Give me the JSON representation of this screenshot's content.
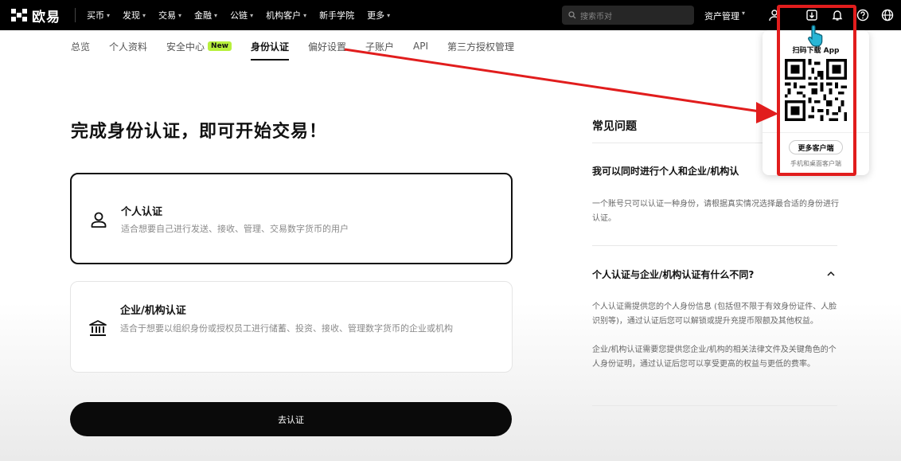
{
  "topnav": {
    "logo_text": "欧易",
    "items": [
      {
        "label": "买币",
        "has_chevron": true
      },
      {
        "label": "发现",
        "has_chevron": true
      },
      {
        "label": "交易",
        "has_chevron": true
      },
      {
        "label": "金融",
        "has_chevron": true
      },
      {
        "label": "公链",
        "has_chevron": true
      },
      {
        "label": "机构客户",
        "has_chevron": true
      },
      {
        "label": "新手学院",
        "has_chevron": false
      },
      {
        "label": "更多",
        "has_chevron": true
      }
    ],
    "search_placeholder": "搜索币对",
    "asset_label": "资产管理",
    "icons": [
      "user-icon",
      "download-icon",
      "bell-icon",
      "help-icon",
      "globe-icon"
    ]
  },
  "subnav": {
    "tabs": [
      {
        "label": "总览"
      },
      {
        "label": "个人资料"
      },
      {
        "label": "安全中心",
        "badge": "New"
      },
      {
        "label": "身份认证",
        "active": true
      },
      {
        "label": "偏好设置"
      },
      {
        "label": "子账户"
      },
      {
        "label": "API"
      },
      {
        "label": "第三方授权管理"
      }
    ]
  },
  "main": {
    "title": "完成身份认证，即可开始交易！",
    "personal": {
      "title": "个人认证",
      "desc": "适合想要自己进行发送、接收、管理、交易数字货币的用户"
    },
    "institution": {
      "title": "企业/机构认证",
      "desc": "适合于想要以组织身份或授权员工进行储蓄、投资、接收、管理数字货币的企业或机构"
    },
    "go_button": "去认证"
  },
  "faq": {
    "title": "常见问题",
    "q1": "我可以同时进行个人和企业/机构认",
    "a1": "一个账号只可以认证一种身份，请根据真实情况选择最合适的身份进行认证。",
    "q2": "个人认证与企业/机构认证有什么不同?",
    "a2_p1": "个人认证需提供您的个人身份信息 (包括但不限于有效身份证件、人脸识别等)，通过认证后您可以解锁或提升充提币限额及其他权益。",
    "a2_p2": "企业/机构认证需要您提供您企业/机构的相关法律文件及关键角色的个人身份证明，通过认证后您可以享受更高的权益与更低的费率。"
  },
  "popup": {
    "title": "扫码下载 App",
    "more_button": "更多客户端",
    "subtitle": "手机和桌面客户端"
  },
  "colors": {
    "accent_badge": "#b7f03c",
    "annotation_red": "#e11d1d",
    "nav_bg": "#000000"
  }
}
